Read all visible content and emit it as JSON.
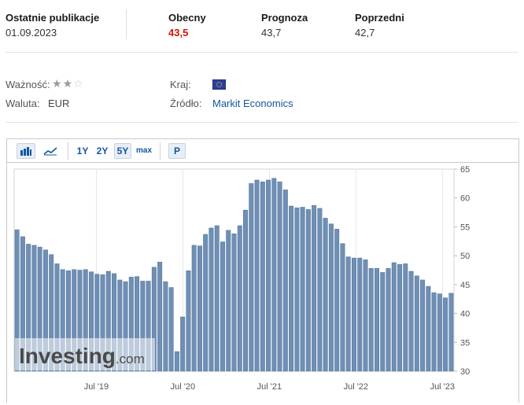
{
  "summary": {
    "latest_label": "Ostatnie publikacje",
    "latest_date": "01.09.2023",
    "actual_label": "Obecny",
    "actual_value": "43,5",
    "forecast_label": "Prognoza",
    "forecast_value": "43,7",
    "previous_label": "Poprzedni",
    "previous_value": "42,7"
  },
  "details": {
    "importance_label": "Ważność:",
    "importance_stars": 2,
    "importance_max": 3,
    "currency_label": "Waluta:",
    "currency_value": "EUR",
    "country_label": "Kraj:",
    "country_flag": "eu-flag-icon",
    "source_label": "Źródło:",
    "source_value": "Markit Economics"
  },
  "toolbar": {
    "bar_chart_icon": "bar-chart-icon",
    "line_chart_icon": "line-chart-icon",
    "range_1y": "1Y",
    "range_2y": "2Y",
    "range_5y": "5Y",
    "range_max": "max",
    "p_button": "P",
    "selected_range": "5Y"
  },
  "watermark": {
    "brand": "Investing",
    "suffix": ".com"
  },
  "colors": {
    "bar": "#6f8fb5",
    "bar_edge": "#4f6f96",
    "accent_red": "#d91400",
    "link": "#1256a0"
  },
  "chart_data": {
    "type": "bar",
    "title": "",
    "xlabel": "",
    "ylabel": "",
    "ylim": [
      30,
      65
    ],
    "yticks": [
      "65",
      "60",
      "55",
      "50",
      "45",
      "40",
      "35",
      "30"
    ],
    "xticks": [
      {
        "label": "Jul '19",
        "index": 11
      },
      {
        "label": "Jul '20",
        "index": 23
      },
      {
        "label": "Jul '21",
        "index": 35
      },
      {
        "label": "Jul '22",
        "index": 47
      },
      {
        "label": "Jul '23",
        "index": 59
      }
    ],
    "categories": [
      "2018-09",
      "2018-10",
      "2018-11",
      "2018-12",
      "2019-01",
      "2019-02",
      "2019-03",
      "2019-04",
      "2019-05",
      "2019-06",
      "2019-07",
      "2019-08",
      "2019-09",
      "2019-10",
      "2019-11",
      "2019-12",
      "2020-01",
      "2020-02",
      "2020-03",
      "2020-04",
      "2020-05",
      "2020-06",
      "2020-07",
      "2020-08",
      "2020-09",
      "2020-10",
      "2020-11",
      "2020-12",
      "2021-01",
      "2021-02",
      "2021-03",
      "2021-04",
      "2021-05",
      "2021-06",
      "2021-07",
      "2021-08",
      "2021-09",
      "2021-10",
      "2021-11",
      "2021-12",
      "2022-01",
      "2022-02",
      "2022-03",
      "2022-04",
      "2022-05",
      "2022-06",
      "2022-07",
      "2022-08",
      "2022-09",
      "2022-10",
      "2022-11",
      "2022-12",
      "2023-01",
      "2023-02",
      "2023-03",
      "2023-04",
      "2023-05",
      "2023-06",
      "2023-07",
      "2023-08",
      "2023-09"
    ],
    "values": [
      54.5,
      53.3,
      52.0,
      51.8,
      51.5,
      51.0,
      50.2,
      48.6,
      47.6,
      47.4,
      47.6,
      47.5,
      47.6,
      47.2,
      46.8,
      46.7,
      47.3,
      46.9,
      45.8,
      45.5,
      46.3,
      46.4,
      45.6,
      45.6,
      48.0,
      48.9,
      45.5,
      44.5,
      33.4,
      39.4,
      47.4,
      51.8,
      51.7,
      53.7,
      54.8,
      55.2,
      52.4,
      54.4,
      53.8,
      55.2,
      57.9,
      62.5,
      63.1,
      62.8,
      63.1,
      63.4,
      62.8,
      61.4,
      58.6,
      58.3,
      58.4,
      58.0,
      58.7,
      58.2,
      56.5,
      55.5,
      54.6,
      52.1,
      49.8,
      49.6,
      49.6,
      49.3,
      47.8,
      47.8,
      47.1,
      47.8,
      48.8,
      48.5,
      48.6,
      47.3,
      46.5,
      45.8,
      44.7,
      43.6,
      43.4,
      42.7,
      43.5
    ]
  }
}
